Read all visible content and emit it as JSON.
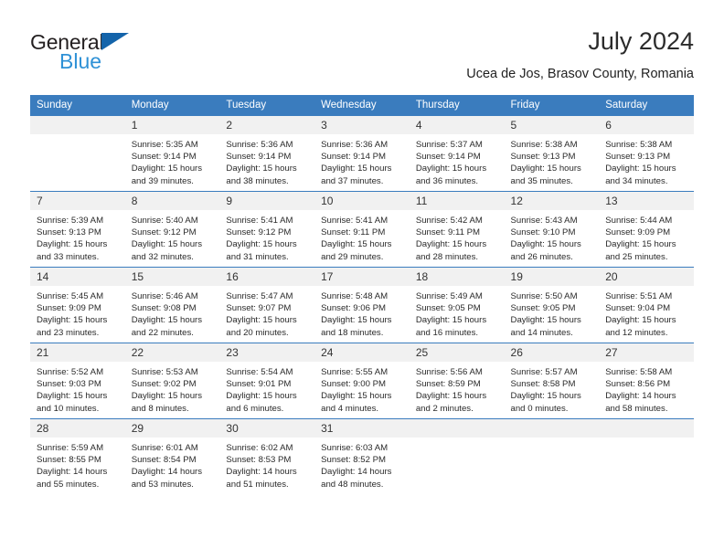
{
  "logo": {
    "word_general": "General",
    "word_blue": "Blue",
    "triangle_color": "#1464aa",
    "blue_color": "#2e91d6"
  },
  "header": {
    "title": "July 2024",
    "subtitle": "Ucea de Jos, Brasov County, Romania"
  },
  "theme": {
    "header_bg": "#3a7cbe",
    "daynum_bg": "#f1f1f1",
    "text": "#2a2a2a"
  },
  "weekdays": [
    "Sunday",
    "Monday",
    "Tuesday",
    "Wednesday",
    "Thursday",
    "Friday",
    "Saturday"
  ],
  "weeks": [
    [
      {
        "day": "",
        "lines": []
      },
      {
        "day": "1",
        "lines": [
          "Sunrise: 5:35 AM",
          "Sunset: 9:14 PM",
          "Daylight: 15 hours",
          "and 39 minutes."
        ]
      },
      {
        "day": "2",
        "lines": [
          "Sunrise: 5:36 AM",
          "Sunset: 9:14 PM",
          "Daylight: 15 hours",
          "and 38 minutes."
        ]
      },
      {
        "day": "3",
        "lines": [
          "Sunrise: 5:36 AM",
          "Sunset: 9:14 PM",
          "Daylight: 15 hours",
          "and 37 minutes."
        ]
      },
      {
        "day": "4",
        "lines": [
          "Sunrise: 5:37 AM",
          "Sunset: 9:14 PM",
          "Daylight: 15 hours",
          "and 36 minutes."
        ]
      },
      {
        "day": "5",
        "lines": [
          "Sunrise: 5:38 AM",
          "Sunset: 9:13 PM",
          "Daylight: 15 hours",
          "and 35 minutes."
        ]
      },
      {
        "day": "6",
        "lines": [
          "Sunrise: 5:38 AM",
          "Sunset: 9:13 PM",
          "Daylight: 15 hours",
          "and 34 minutes."
        ]
      }
    ],
    [
      {
        "day": "7",
        "lines": [
          "Sunrise: 5:39 AM",
          "Sunset: 9:13 PM",
          "Daylight: 15 hours",
          "and 33 minutes."
        ]
      },
      {
        "day": "8",
        "lines": [
          "Sunrise: 5:40 AM",
          "Sunset: 9:12 PM",
          "Daylight: 15 hours",
          "and 32 minutes."
        ]
      },
      {
        "day": "9",
        "lines": [
          "Sunrise: 5:41 AM",
          "Sunset: 9:12 PM",
          "Daylight: 15 hours",
          "and 31 minutes."
        ]
      },
      {
        "day": "10",
        "lines": [
          "Sunrise: 5:41 AM",
          "Sunset: 9:11 PM",
          "Daylight: 15 hours",
          "and 29 minutes."
        ]
      },
      {
        "day": "11",
        "lines": [
          "Sunrise: 5:42 AM",
          "Sunset: 9:11 PM",
          "Daylight: 15 hours",
          "and 28 minutes."
        ]
      },
      {
        "day": "12",
        "lines": [
          "Sunrise: 5:43 AM",
          "Sunset: 9:10 PM",
          "Daylight: 15 hours",
          "and 26 minutes."
        ]
      },
      {
        "day": "13",
        "lines": [
          "Sunrise: 5:44 AM",
          "Sunset: 9:09 PM",
          "Daylight: 15 hours",
          "and 25 minutes."
        ]
      }
    ],
    [
      {
        "day": "14",
        "lines": [
          "Sunrise: 5:45 AM",
          "Sunset: 9:09 PM",
          "Daylight: 15 hours",
          "and 23 minutes."
        ]
      },
      {
        "day": "15",
        "lines": [
          "Sunrise: 5:46 AM",
          "Sunset: 9:08 PM",
          "Daylight: 15 hours",
          "and 22 minutes."
        ]
      },
      {
        "day": "16",
        "lines": [
          "Sunrise: 5:47 AM",
          "Sunset: 9:07 PM",
          "Daylight: 15 hours",
          "and 20 minutes."
        ]
      },
      {
        "day": "17",
        "lines": [
          "Sunrise: 5:48 AM",
          "Sunset: 9:06 PM",
          "Daylight: 15 hours",
          "and 18 minutes."
        ]
      },
      {
        "day": "18",
        "lines": [
          "Sunrise: 5:49 AM",
          "Sunset: 9:05 PM",
          "Daylight: 15 hours",
          "and 16 minutes."
        ]
      },
      {
        "day": "19",
        "lines": [
          "Sunrise: 5:50 AM",
          "Sunset: 9:05 PM",
          "Daylight: 15 hours",
          "and 14 minutes."
        ]
      },
      {
        "day": "20",
        "lines": [
          "Sunrise: 5:51 AM",
          "Sunset: 9:04 PM",
          "Daylight: 15 hours",
          "and 12 minutes."
        ]
      }
    ],
    [
      {
        "day": "21",
        "lines": [
          "Sunrise: 5:52 AM",
          "Sunset: 9:03 PM",
          "Daylight: 15 hours",
          "and 10 minutes."
        ]
      },
      {
        "day": "22",
        "lines": [
          "Sunrise: 5:53 AM",
          "Sunset: 9:02 PM",
          "Daylight: 15 hours",
          "and 8 minutes."
        ]
      },
      {
        "day": "23",
        "lines": [
          "Sunrise: 5:54 AM",
          "Sunset: 9:01 PM",
          "Daylight: 15 hours",
          "and 6 minutes."
        ]
      },
      {
        "day": "24",
        "lines": [
          "Sunrise: 5:55 AM",
          "Sunset: 9:00 PM",
          "Daylight: 15 hours",
          "and 4 minutes."
        ]
      },
      {
        "day": "25",
        "lines": [
          "Sunrise: 5:56 AM",
          "Sunset: 8:59 PM",
          "Daylight: 15 hours",
          "and 2 minutes."
        ]
      },
      {
        "day": "26",
        "lines": [
          "Sunrise: 5:57 AM",
          "Sunset: 8:58 PM",
          "Daylight: 15 hours",
          "and 0 minutes."
        ]
      },
      {
        "day": "27",
        "lines": [
          "Sunrise: 5:58 AM",
          "Sunset: 8:56 PM",
          "Daylight: 14 hours",
          "and 58 minutes."
        ]
      }
    ],
    [
      {
        "day": "28",
        "lines": [
          "Sunrise: 5:59 AM",
          "Sunset: 8:55 PM",
          "Daylight: 14 hours",
          "and 55 minutes."
        ]
      },
      {
        "day": "29",
        "lines": [
          "Sunrise: 6:01 AM",
          "Sunset: 8:54 PM",
          "Daylight: 14 hours",
          "and 53 minutes."
        ]
      },
      {
        "day": "30",
        "lines": [
          "Sunrise: 6:02 AM",
          "Sunset: 8:53 PM",
          "Daylight: 14 hours",
          "and 51 minutes."
        ]
      },
      {
        "day": "31",
        "lines": [
          "Sunrise: 6:03 AM",
          "Sunset: 8:52 PM",
          "Daylight: 14 hours",
          "and 48 minutes."
        ]
      },
      {
        "day": "",
        "lines": []
      },
      {
        "day": "",
        "lines": []
      },
      {
        "day": "",
        "lines": []
      }
    ]
  ]
}
